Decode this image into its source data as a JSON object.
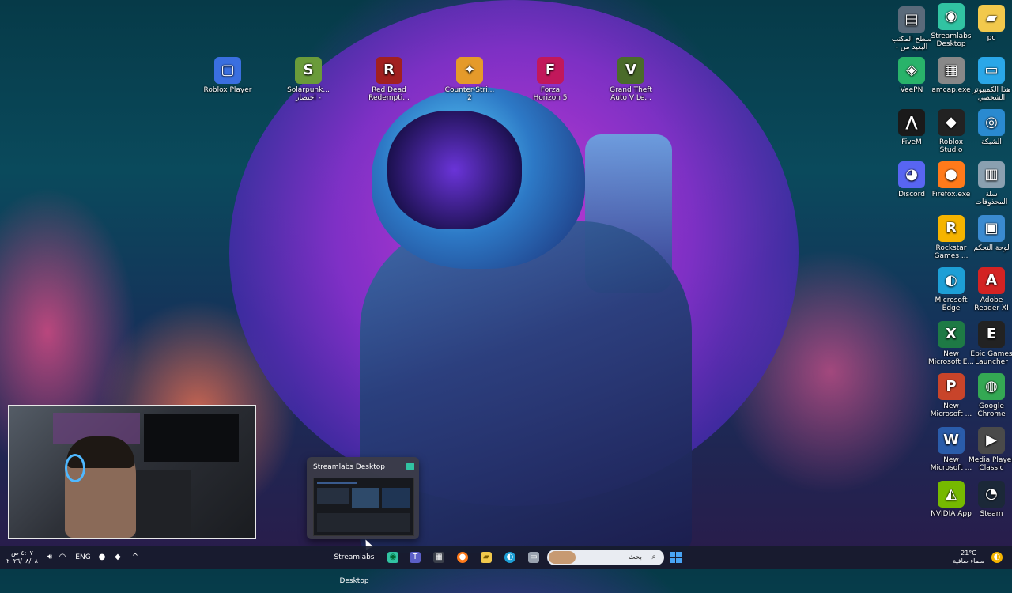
{
  "desktop_icons": [
    {
      "id": "roblox-player",
      "label": "Roblox Player",
      "glyph": "▢",
      "color": "#3a6fe0"
    },
    {
      "id": "solarpunk",
      "label": "Solarpunk...\nاختصار -",
      "glyph": "S",
      "color": "#6a9b3a"
    },
    {
      "id": "red-dead",
      "label": "Red Dead\nRedempti...",
      "glyph": "R",
      "color": "#a12020"
    },
    {
      "id": "counter-strike",
      "label": "Counter-Stri...\n2",
      "glyph": "✦",
      "color": "#e59a2a"
    },
    {
      "id": "forza",
      "label": "Forza\nHorizon 5",
      "glyph": "F",
      "color": "#c2185b"
    },
    {
      "id": "gta",
      "label": "Grand Theft\nAuto V Le...",
      "glyph": "V",
      "color": "#4a6b2a"
    },
    {
      "id": "desktop-shortcut",
      "label": "سطح المكتب\n- البعيد من",
      "glyph": "▤",
      "color": "#5a6a7a"
    },
    {
      "id": "streamlabs",
      "label": "Streamlabs\nDesktop",
      "glyph": "◉",
      "color": "#31c3a2"
    },
    {
      "id": "pc",
      "label": "pc",
      "glyph": "▰",
      "color": "#f2c94c"
    },
    {
      "id": "veepn",
      "label": "VeePN",
      "glyph": "◈",
      "color": "#29b36a"
    },
    {
      "id": "amcap",
      "label": "amcap.exe",
      "glyph": "▦",
      "color": "#888888"
    },
    {
      "id": "this-pc",
      "label": "هذا الكمبيوتر\nالشخصي",
      "glyph": "▭",
      "color": "#2aa7e8"
    },
    {
      "id": "fivem",
      "label": "FiveM",
      "glyph": "⋀",
      "color": "#1a1a1a"
    },
    {
      "id": "roblox-studio",
      "label": "Roblox\nStudio",
      "glyph": "◆",
      "color": "#222222"
    },
    {
      "id": "network",
      "label": "الشبكة",
      "glyph": "◎",
      "color": "#2a8ad0"
    },
    {
      "id": "discord",
      "label": "Discord",
      "glyph": "◕",
      "color": "#5865f2"
    },
    {
      "id": "firefox",
      "label": "Firefox.exe",
      "glyph": "●",
      "color": "#ff7a1a"
    },
    {
      "id": "recycle-bin",
      "label": "سلة\nالمحذوفات",
      "glyph": "▥",
      "color": "#8aa0b0"
    },
    {
      "id": "rockstar",
      "label": "Rockstar\nGames ...",
      "glyph": "R",
      "color": "#f5b400"
    },
    {
      "id": "control-panel",
      "label": "لوحة التحكم",
      "glyph": "▣",
      "color": "#3a8ad0"
    },
    {
      "id": "edge",
      "label": "Microsoft\nEdge",
      "glyph": "◐",
      "color": "#1d9fd6"
    },
    {
      "id": "adobe",
      "label": "Adobe\nReader XI",
      "glyph": "A",
      "color": "#d32323"
    },
    {
      "id": "excel",
      "label": "New\nMicrosoft E...",
      "glyph": "X",
      "color": "#1e7a45"
    },
    {
      "id": "epic",
      "label": "Epic Games\nLauncher",
      "glyph": "E",
      "color": "#222222"
    },
    {
      "id": "powerpoint",
      "label": "New\nMicrosoft ...",
      "glyph": "P",
      "color": "#c8442a"
    },
    {
      "id": "chrome",
      "label": "Google\nChrome",
      "glyph": "◍",
      "color": "#34a853"
    },
    {
      "id": "word",
      "label": "New\nMicrosoft ...",
      "glyph": "W",
      "color": "#2a5caa"
    },
    {
      "id": "mpc",
      "label": "Media Player\nClassic",
      "glyph": "▶",
      "color": "#4a4a4a"
    },
    {
      "id": "nvidia",
      "label": "NVIDIA App",
      "glyph": "◭",
      "color": "#76b900"
    },
    {
      "id": "steam",
      "label": "Steam",
      "glyph": "◔",
      "color": "#1b2838"
    }
  ],
  "preview": {
    "title": "Streamlabs Desktop"
  },
  "taskbar": {
    "time": "٤:٠٧ ص",
    "date": "٢٠٢٦/٠٨/٠٨",
    "language": "ENG",
    "active_app": "Streamlabs Desktop",
    "search_placeholder": "بحث",
    "weather_temp": "21°C",
    "weather_desc": "سماء صافية"
  }
}
